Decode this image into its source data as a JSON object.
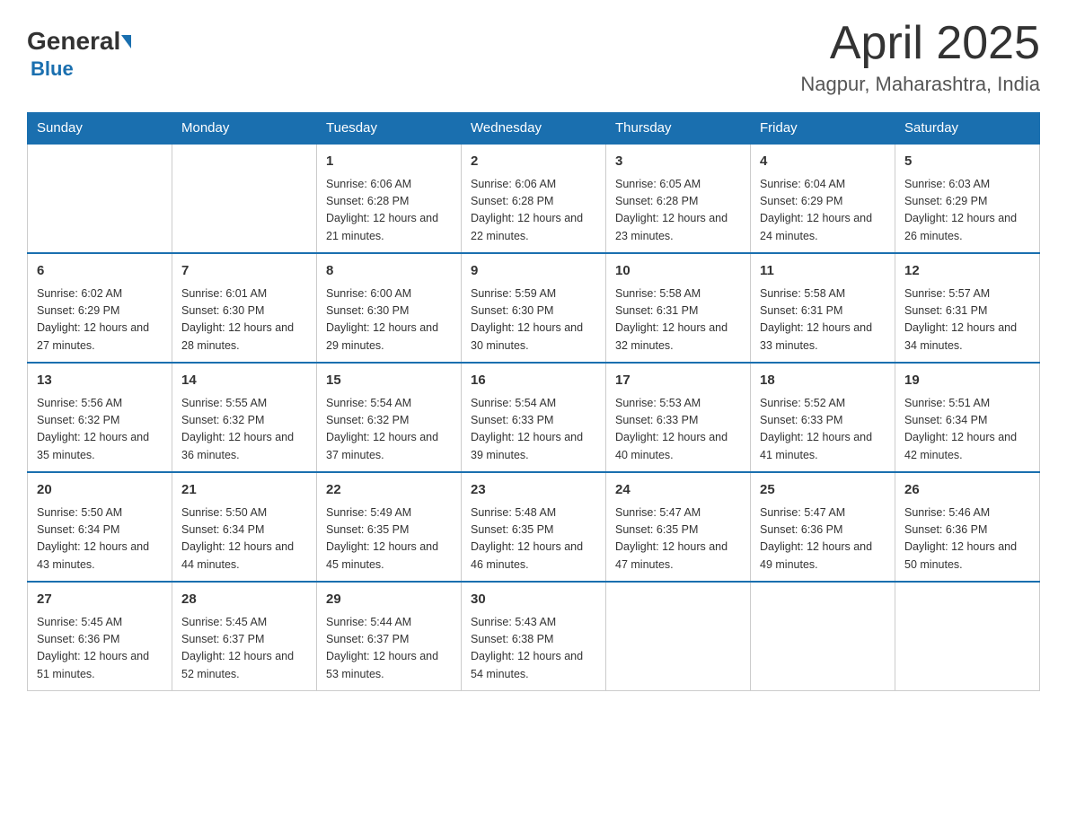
{
  "header": {
    "logo_general": "General",
    "logo_blue": "Blue",
    "title": "April 2025",
    "subtitle": "Nagpur, Maharashtra, India"
  },
  "days_of_week": [
    "Sunday",
    "Monday",
    "Tuesday",
    "Wednesday",
    "Thursday",
    "Friday",
    "Saturday"
  ],
  "weeks": [
    [
      {
        "day": "",
        "sunrise": "",
        "sunset": "",
        "daylight": ""
      },
      {
        "day": "",
        "sunrise": "",
        "sunset": "",
        "daylight": ""
      },
      {
        "day": "1",
        "sunrise": "Sunrise: 6:06 AM",
        "sunset": "Sunset: 6:28 PM",
        "daylight": "Daylight: 12 hours and 21 minutes."
      },
      {
        "day": "2",
        "sunrise": "Sunrise: 6:06 AM",
        "sunset": "Sunset: 6:28 PM",
        "daylight": "Daylight: 12 hours and 22 minutes."
      },
      {
        "day": "3",
        "sunrise": "Sunrise: 6:05 AM",
        "sunset": "Sunset: 6:28 PM",
        "daylight": "Daylight: 12 hours and 23 minutes."
      },
      {
        "day": "4",
        "sunrise": "Sunrise: 6:04 AM",
        "sunset": "Sunset: 6:29 PM",
        "daylight": "Daylight: 12 hours and 24 minutes."
      },
      {
        "day": "5",
        "sunrise": "Sunrise: 6:03 AM",
        "sunset": "Sunset: 6:29 PM",
        "daylight": "Daylight: 12 hours and 26 minutes."
      }
    ],
    [
      {
        "day": "6",
        "sunrise": "Sunrise: 6:02 AM",
        "sunset": "Sunset: 6:29 PM",
        "daylight": "Daylight: 12 hours and 27 minutes."
      },
      {
        "day": "7",
        "sunrise": "Sunrise: 6:01 AM",
        "sunset": "Sunset: 6:30 PM",
        "daylight": "Daylight: 12 hours and 28 minutes."
      },
      {
        "day": "8",
        "sunrise": "Sunrise: 6:00 AM",
        "sunset": "Sunset: 6:30 PM",
        "daylight": "Daylight: 12 hours and 29 minutes."
      },
      {
        "day": "9",
        "sunrise": "Sunrise: 5:59 AM",
        "sunset": "Sunset: 6:30 PM",
        "daylight": "Daylight: 12 hours and 30 minutes."
      },
      {
        "day": "10",
        "sunrise": "Sunrise: 5:58 AM",
        "sunset": "Sunset: 6:31 PM",
        "daylight": "Daylight: 12 hours and 32 minutes."
      },
      {
        "day": "11",
        "sunrise": "Sunrise: 5:58 AM",
        "sunset": "Sunset: 6:31 PM",
        "daylight": "Daylight: 12 hours and 33 minutes."
      },
      {
        "day": "12",
        "sunrise": "Sunrise: 5:57 AM",
        "sunset": "Sunset: 6:31 PM",
        "daylight": "Daylight: 12 hours and 34 minutes."
      }
    ],
    [
      {
        "day": "13",
        "sunrise": "Sunrise: 5:56 AM",
        "sunset": "Sunset: 6:32 PM",
        "daylight": "Daylight: 12 hours and 35 minutes."
      },
      {
        "day": "14",
        "sunrise": "Sunrise: 5:55 AM",
        "sunset": "Sunset: 6:32 PM",
        "daylight": "Daylight: 12 hours and 36 minutes."
      },
      {
        "day": "15",
        "sunrise": "Sunrise: 5:54 AM",
        "sunset": "Sunset: 6:32 PM",
        "daylight": "Daylight: 12 hours and 37 minutes."
      },
      {
        "day": "16",
        "sunrise": "Sunrise: 5:54 AM",
        "sunset": "Sunset: 6:33 PM",
        "daylight": "Daylight: 12 hours and 39 minutes."
      },
      {
        "day": "17",
        "sunrise": "Sunrise: 5:53 AM",
        "sunset": "Sunset: 6:33 PM",
        "daylight": "Daylight: 12 hours and 40 minutes."
      },
      {
        "day": "18",
        "sunrise": "Sunrise: 5:52 AM",
        "sunset": "Sunset: 6:33 PM",
        "daylight": "Daylight: 12 hours and 41 minutes."
      },
      {
        "day": "19",
        "sunrise": "Sunrise: 5:51 AM",
        "sunset": "Sunset: 6:34 PM",
        "daylight": "Daylight: 12 hours and 42 minutes."
      }
    ],
    [
      {
        "day": "20",
        "sunrise": "Sunrise: 5:50 AM",
        "sunset": "Sunset: 6:34 PM",
        "daylight": "Daylight: 12 hours and 43 minutes."
      },
      {
        "day": "21",
        "sunrise": "Sunrise: 5:50 AM",
        "sunset": "Sunset: 6:34 PM",
        "daylight": "Daylight: 12 hours and 44 minutes."
      },
      {
        "day": "22",
        "sunrise": "Sunrise: 5:49 AM",
        "sunset": "Sunset: 6:35 PM",
        "daylight": "Daylight: 12 hours and 45 minutes."
      },
      {
        "day": "23",
        "sunrise": "Sunrise: 5:48 AM",
        "sunset": "Sunset: 6:35 PM",
        "daylight": "Daylight: 12 hours and 46 minutes."
      },
      {
        "day": "24",
        "sunrise": "Sunrise: 5:47 AM",
        "sunset": "Sunset: 6:35 PM",
        "daylight": "Daylight: 12 hours and 47 minutes."
      },
      {
        "day": "25",
        "sunrise": "Sunrise: 5:47 AM",
        "sunset": "Sunset: 6:36 PM",
        "daylight": "Daylight: 12 hours and 49 minutes."
      },
      {
        "day": "26",
        "sunrise": "Sunrise: 5:46 AM",
        "sunset": "Sunset: 6:36 PM",
        "daylight": "Daylight: 12 hours and 50 minutes."
      }
    ],
    [
      {
        "day": "27",
        "sunrise": "Sunrise: 5:45 AM",
        "sunset": "Sunset: 6:36 PM",
        "daylight": "Daylight: 12 hours and 51 minutes."
      },
      {
        "day": "28",
        "sunrise": "Sunrise: 5:45 AM",
        "sunset": "Sunset: 6:37 PM",
        "daylight": "Daylight: 12 hours and 52 minutes."
      },
      {
        "day": "29",
        "sunrise": "Sunrise: 5:44 AM",
        "sunset": "Sunset: 6:37 PM",
        "daylight": "Daylight: 12 hours and 53 minutes."
      },
      {
        "day": "30",
        "sunrise": "Sunrise: 5:43 AM",
        "sunset": "Sunset: 6:38 PM",
        "daylight": "Daylight: 12 hours and 54 minutes."
      },
      {
        "day": "",
        "sunrise": "",
        "sunset": "",
        "daylight": ""
      },
      {
        "day": "",
        "sunrise": "",
        "sunset": "",
        "daylight": ""
      },
      {
        "day": "",
        "sunrise": "",
        "sunset": "",
        "daylight": ""
      }
    ]
  ]
}
